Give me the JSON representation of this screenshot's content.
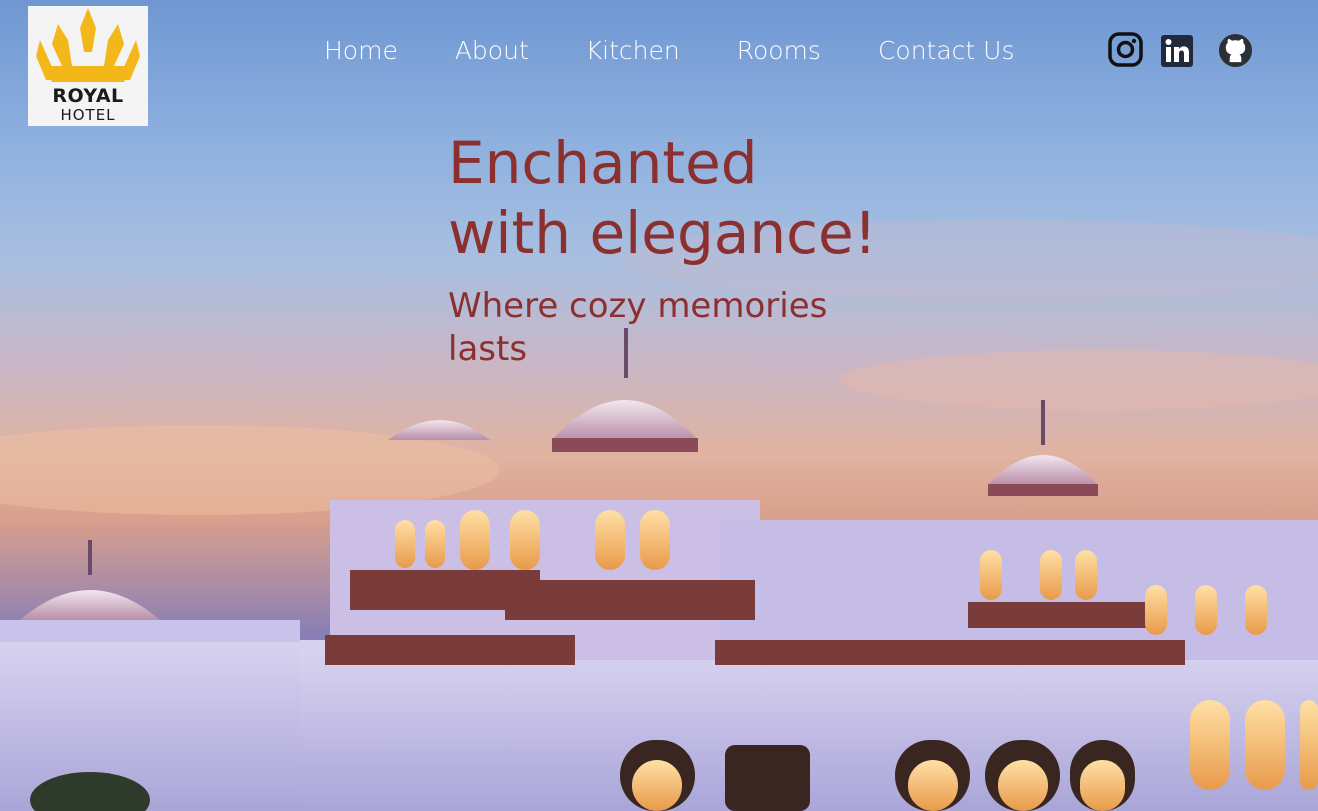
{
  "brand": {
    "line1": "ROYAL",
    "line2": "HOTEL",
    "crown_color": "#f4b719"
  },
  "nav": {
    "items": [
      {
        "label": "Home"
      },
      {
        "label": "About"
      },
      {
        "label": "Kitchen"
      },
      {
        "label": "Rooms"
      },
      {
        "label": "Contact Us"
      }
    ]
  },
  "social": {
    "icons": [
      "instagram-icon",
      "linkedin-icon",
      "github-icon"
    ]
  },
  "hero": {
    "headline_line1": "Enchanted",
    "headline_line2": "with elegance!",
    "subline": "Where cozy memories lasts",
    "text_color": "#8b2f2f"
  }
}
